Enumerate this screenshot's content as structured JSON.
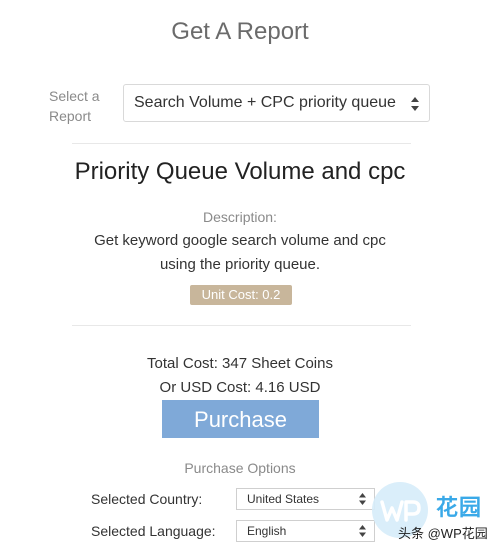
{
  "header": {
    "title": "Get A Report"
  },
  "report_selector": {
    "label": "Select a Report",
    "selected": "Search Volume + CPC priority queue"
  },
  "report": {
    "title": "Priority Queue Volume and cpc",
    "description_label": "Description:",
    "description": "Get keyword google search volume and cpc using the priority queue.",
    "unit_cost": "Unit Cost: 0.2"
  },
  "cost": {
    "total": "Total Cost: 347 Sheet Coins",
    "usd": "Or USD Cost: 4.16 USD"
  },
  "purchase": {
    "label": "Purchase"
  },
  "options": {
    "title": "Purchase Options",
    "country_label": "Selected Country:",
    "country_value": "United States",
    "language_label": "Selected Language:",
    "language_value": "English"
  },
  "watermark": {
    "brand": "花园",
    "credit": "头条 @WP花园"
  },
  "colors": {
    "accent_button": "#7fa9d8",
    "unit_cost_badge": "#c8b69b",
    "watermark_blue": "#3aa9e8"
  }
}
